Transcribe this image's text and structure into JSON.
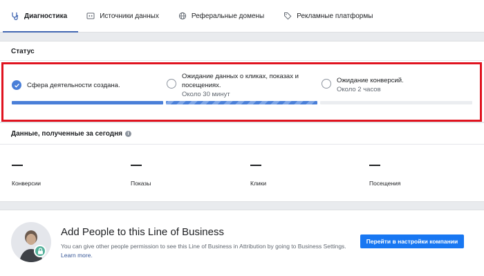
{
  "tabs": [
    {
      "label": "Диагностика",
      "icon": "stethoscope-icon",
      "active": true
    },
    {
      "label": "Источники данных",
      "icon": "code-window-icon",
      "active": false
    },
    {
      "label": "Реферальные домены",
      "icon": "globe-icon",
      "active": false
    },
    {
      "label": "Рекламные платформы",
      "icon": "tag-icon",
      "active": false
    }
  ],
  "status": {
    "title": "Статус",
    "steps": [
      {
        "text": "Сфера деятельности создана.",
        "sub": "",
        "done": true,
        "progress": 1.0
      },
      {
        "text_line1": "Ожидание данных о кликах, показах и",
        "text_line2": "посещениях.",
        "sub": "Около 30 минут",
        "done": false,
        "progress": 1.0,
        "striped": true
      },
      {
        "text": "Ожидание конверсий.",
        "sub": "Около 2 часов",
        "done": false,
        "progress": 0
      }
    ],
    "highlight_color": "#e0131f"
  },
  "today": {
    "title": "Данные, полученные за сегодня",
    "metrics": [
      {
        "value": "—",
        "label": "Конверсии"
      },
      {
        "value": "—",
        "label": "Показы"
      },
      {
        "value": "—",
        "label": "Клики"
      },
      {
        "value": "—",
        "label": "Посещения"
      }
    ]
  },
  "people": {
    "title": "Add People to this Line of Business",
    "description": "You can give other people permission to see this Line of Business in Attribution by going to Business Settings.",
    "learn_more": "Learn more.",
    "button_label": "Перейти в настройки компании"
  },
  "colors": {
    "accent": "#4267b2",
    "progress": "#4a7fd8",
    "button": "#1877f2",
    "lock_badge": "#52b09a"
  }
}
